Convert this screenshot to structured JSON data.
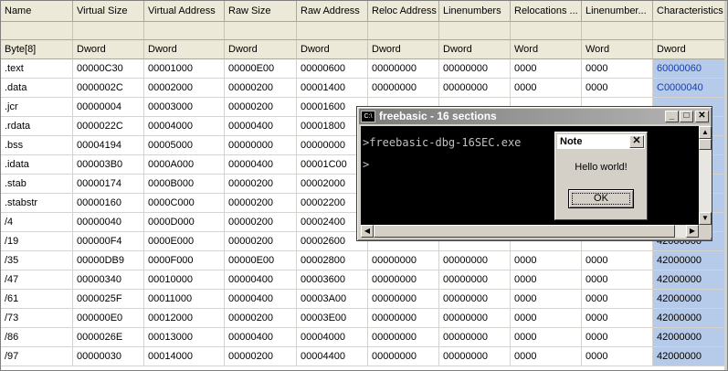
{
  "table": {
    "columns": [
      "Name",
      "Virtual Size",
      "Virtual Address",
      "Raw Size",
      "Raw Address",
      "Reloc Address",
      "Linenumbers",
      "Relocations ...",
      "Linenumber...",
      "Characteristics"
    ],
    "types": [
      "Byte[8]",
      "Dword",
      "Dword",
      "Dword",
      "Dword",
      "Dword",
      "Dword",
      "Word",
      "Word",
      "Dword"
    ],
    "rows": [
      [
        ".text",
        "00000C30",
        "00001000",
        "00000E00",
        "00000600",
        "00000000",
        "00000000",
        "0000",
        "0000",
        "60000060"
      ],
      [
        ".data",
        "0000002C",
        "00002000",
        "00000200",
        "00001400",
        "00000000",
        "00000000",
        "0000",
        "0000",
        "C0000040"
      ],
      [
        ".jcr",
        "00000004",
        "00003000",
        "00000200",
        "00001600",
        "",
        "",
        "",
        "",
        ""
      ],
      [
        ".rdata",
        "0000022C",
        "00004000",
        "00000400",
        "00001800",
        "",
        "",
        "",
        "",
        ""
      ],
      [
        ".bss",
        "00004194",
        "00005000",
        "00000000",
        "00000000",
        "",
        "",
        "",
        "",
        ""
      ],
      [
        ".idata",
        "000003B0",
        "0000A000",
        "00000400",
        "00001C00",
        "",
        "",
        "",
        "",
        ""
      ],
      [
        ".stab",
        "00000174",
        "0000B000",
        "00000200",
        "00002000",
        "",
        "",
        "",
        "",
        ""
      ],
      [
        ".stabstr",
        "00000160",
        "0000C000",
        "00000200",
        "00002200",
        "",
        "",
        "",
        "",
        ""
      ],
      [
        "/4",
        "00000040",
        "0000D000",
        "00000200",
        "00002400",
        "",
        "",
        "",
        "",
        ""
      ],
      [
        "/19",
        "000000F4",
        "0000E000",
        "00000200",
        "00002600",
        "",
        "",
        "",
        "",
        "42000000"
      ],
      [
        "/35",
        "00000DB9",
        "0000F000",
        "00000E00",
        "00002800",
        "00000000",
        "00000000",
        "0000",
        "0000",
        "42000000"
      ],
      [
        "/47",
        "00000340",
        "00010000",
        "00000400",
        "00003600",
        "00000000",
        "00000000",
        "0000",
        "0000",
        "42000000"
      ],
      [
        "/61",
        "0000025F",
        "00011000",
        "00000400",
        "00003A00",
        "00000000",
        "00000000",
        "0000",
        "0000",
        "42000000"
      ],
      [
        "/73",
        "000000E0",
        "00012000",
        "00000200",
        "00003E00",
        "00000000",
        "00000000",
        "0000",
        "0000",
        "42000000"
      ],
      [
        "/86",
        "0000026E",
        "00013000",
        "00000400",
        "00004000",
        "00000000",
        "00000000",
        "0000",
        "0000",
        "42000000"
      ],
      [
        "/97",
        "00000030",
        "00014000",
        "00000200",
        "00004400",
        "00000000",
        "00000000",
        "0000",
        "0000",
        "42000000"
      ]
    ]
  },
  "console": {
    "title": "freebasic - 16 sections",
    "icon_label": "C:\\",
    "lines": [
      ">freebasic-dbg-16SEC.exe",
      ">"
    ],
    "minimize": "_",
    "maximize": "□",
    "close": "✕"
  },
  "msgbox": {
    "title": "Note",
    "close": "✕",
    "message": "Hello world!",
    "ok": "OK"
  },
  "colors": {
    "characteristics_column": "#b6cbe9",
    "header_bg": "#ece9d8",
    "console_bg": "#000000"
  }
}
